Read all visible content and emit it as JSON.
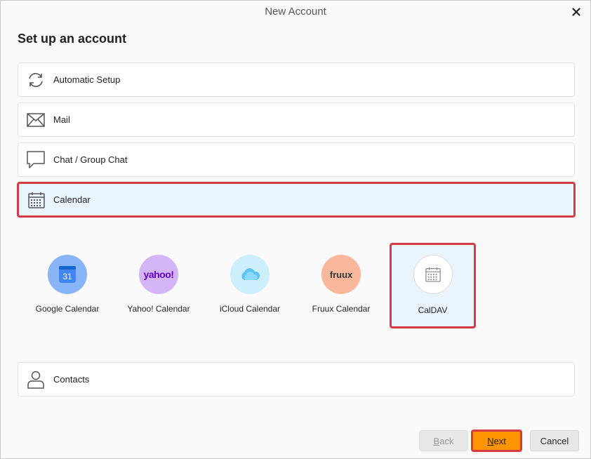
{
  "window": {
    "title": "New Account"
  },
  "heading": "Set up an account",
  "rows": {
    "automatic": "Automatic Setup",
    "mail": "Mail",
    "chat": "Chat / Group Chat",
    "calendar": "Calendar",
    "contacts": "Contacts"
  },
  "providers": {
    "google": {
      "label": "Google Calendar",
      "badge": "31"
    },
    "yahoo": {
      "label": "Yahoo! Calendar",
      "badge": "yahoo!"
    },
    "icloud": {
      "label": "iCloud Calendar"
    },
    "fruux": {
      "label": "Fruux Calendar",
      "badge": "fruux"
    },
    "caldav": {
      "label": "CalDAV"
    }
  },
  "buttons": {
    "back": {
      "underlined": "B",
      "rest": "ack"
    },
    "next": {
      "underlined": "N",
      "rest": "ext"
    },
    "cancel": "Cancel"
  },
  "colors": {
    "highlight": "#d63a47",
    "selected_bg": "#eaf4fd",
    "next_bg": "#ff9500"
  },
  "icons": [
    "close-icon",
    "sync-icon",
    "mail-icon",
    "chat-icon",
    "calendar-icon",
    "contact-icon"
  ]
}
